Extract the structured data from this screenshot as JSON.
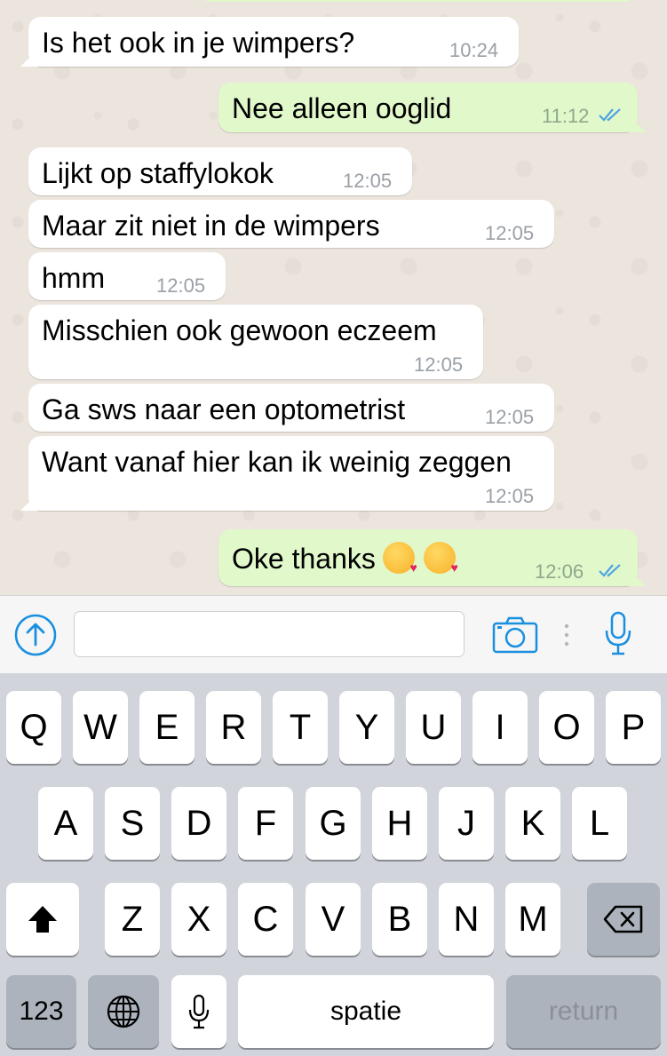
{
  "messages": [
    {
      "text": "Is het ook in je wimpers?",
      "time": "10:24",
      "direction": "in"
    },
    {
      "text": "Nee alleen ooglid",
      "time": "11:12",
      "direction": "out",
      "status": "read"
    },
    {
      "text": "Lijkt op staffylokok",
      "time": "12:05",
      "direction": "in"
    },
    {
      "text": "Maar zit niet in de wimpers",
      "time": "12:05",
      "direction": "in"
    },
    {
      "text": "hmm",
      "time": "12:05",
      "direction": "in"
    },
    {
      "text": "Misschien ook gewoon eczeem",
      "time": "12:05",
      "direction": "in"
    },
    {
      "text": "Ga sws naar een optometrist",
      "time": "12:05",
      "direction": "in"
    },
    {
      "text": "Want vanaf hier kan ik weinig zeggen",
      "time": "12:05",
      "direction": "in"
    },
    {
      "text": "Oke thanks",
      "time": "12:06",
      "direction": "out",
      "status": "read",
      "emojis": [
        "face-throwing-kiss-icon",
        "face-throwing-kiss-icon"
      ]
    }
  ],
  "input_bar": {
    "message_value": "",
    "icons": [
      "upload-arrow-icon",
      "camera-icon",
      "microphone-icon"
    ]
  },
  "colors": {
    "outgoing_bubble": "#e1f8cb",
    "incoming_bubble": "#ffffff",
    "read_ticks": "#4fa3e0",
    "icon_blue": "#1a8fe0",
    "keyboard_bg": "#d1d4da"
  },
  "keyboard": {
    "row1": [
      "Q",
      "W",
      "E",
      "R",
      "T",
      "Y",
      "U",
      "I",
      "O",
      "P"
    ],
    "row2": [
      "A",
      "S",
      "D",
      "F",
      "G",
      "H",
      "J",
      "K",
      "L"
    ],
    "row3": [
      "Z",
      "X",
      "C",
      "V",
      "B",
      "N",
      "M"
    ],
    "shift_icon": "shift-arrow-icon",
    "backspace_icon": "backspace-icon",
    "numbers_label": "123",
    "globe_icon": "globe-icon",
    "dictation_icon": "microphone-icon",
    "space_label": "spatie",
    "return_label": "return"
  }
}
